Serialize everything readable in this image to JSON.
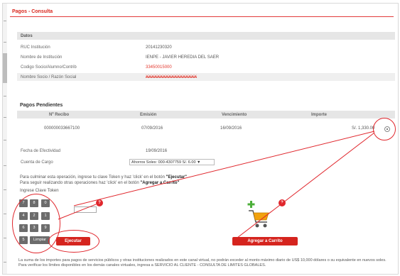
{
  "page": {
    "title": "Pagos - Consulta"
  },
  "datos": {
    "section_label": "Datos",
    "rows": [
      {
        "label": "RUC Institución",
        "value": "20141230320",
        "hidden": false
      },
      {
        "label": "Nombre de Institución",
        "value": "IENPE - JAVIER HEREDIA DEL SAER",
        "hidden": false
      },
      {
        "label": "Codigo Socio/Alumno/Contrib",
        "value": "33450015000",
        "hidden": true
      },
      {
        "label": "Nombre Socio / Razón Social",
        "value": "XXXXXXXXXXXXXXXXXX",
        "hidden": true
      }
    ]
  },
  "pagos": {
    "section_label": "Pagos Pendientes",
    "headers": {
      "recibo": "Nº Recibo",
      "emision": "Emisión",
      "vencimiento": "Vencimiento",
      "importe": "Importe"
    },
    "rows": [
      {
        "recibo": "000000033667100",
        "emision": "07/09/2016",
        "vencimiento": "16/09/2016",
        "importe": "S/. 1,330.00"
      }
    ]
  },
  "form": {
    "fecha_label": "Fecha de Efectividad",
    "fecha_value": "19/09/2016",
    "cuenta_label": "Cuenta de Cargo",
    "cuenta_value": "Ahorros Soles: 000-4307759  S/. 6.00  ▼"
  },
  "instructions": {
    "line1_prefix": "Para culminar esta operación, ingrese tu clave Token y haz 'click' en el botón",
    "line1_bold": "\"Ejecutar\"",
    "line2_prefix": "Para seguir realizando otras operaciones haz 'click' en el botón",
    "line2_bold": "\"Agregar a Carrito\"",
    "token_label": "Ingrese Clave Token"
  },
  "keypad": {
    "keys": [
      "7",
      "8",
      "0",
      "4",
      "2",
      "1",
      "6",
      "3",
      "9",
      "5"
    ],
    "clear_label": "Limpiar"
  },
  "buttons": {
    "ejecutar": "Ejecutar",
    "carrito": "Agregar a Carrito"
  },
  "badges": {
    "token": "?",
    "cart": "?"
  },
  "note": "La suma de los importes para pagos de servicios públicos y otras instituciones realizados en este canal virtual, no podrán exceder al monto máximo diario de US$ 10,000 dólares o su equivalente en nuevos soles. Para verificar los límites disponibles en los demás canales virtuales, ingresa a SERVICIO AL CLIENTE - CONSULTA DE LIMITES GLOBALES.",
  "colors": {
    "accent": "#d5241e",
    "annotation": "#e0262c",
    "cart_plus": "#4caf3a",
    "cart_body": "#f2a20e"
  }
}
